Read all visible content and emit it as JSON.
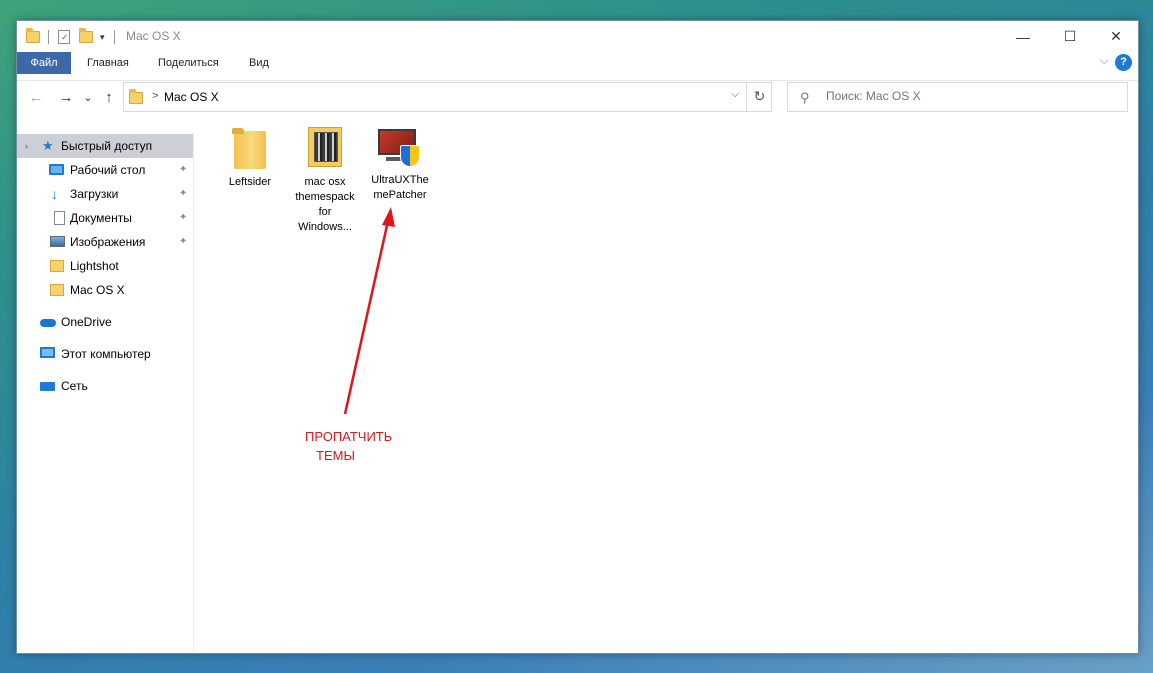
{
  "window": {
    "title": "Mac OS X",
    "controls": {
      "minimize": "—",
      "maximize": "☐",
      "close": "✕"
    }
  },
  "ribbon": {
    "tabs": [
      "Файл",
      "Главная",
      "Поделиться",
      "Вид"
    ],
    "expand_glyph": "⌵",
    "help_glyph": "?"
  },
  "navigation": {
    "back_glyph": "←",
    "forward_glyph": "→",
    "recent_glyph": "⌄",
    "up_glyph": "↑",
    "breadcrumb_sep": ">",
    "path": "Mac OS X",
    "dropdown_glyph": "⌵",
    "refresh_glyph": "↻"
  },
  "search": {
    "placeholder": "Поиск: Mac OS X",
    "icon_glyph": "⚲"
  },
  "sidebar": {
    "items": [
      {
        "label": "Быстрый доступ",
        "icon": "star-icon",
        "pinned": false
      },
      {
        "label": "Рабочий стол",
        "icon": "desktop-icon",
        "pinned": true
      },
      {
        "label": "Загрузки",
        "icon": "downloads-icon",
        "pinned": true
      },
      {
        "label": "Документы",
        "icon": "documents-icon",
        "pinned": true
      },
      {
        "label": "Изображения",
        "icon": "pictures-icon",
        "pinned": true
      },
      {
        "label": "Lightshot",
        "icon": "folder-icon",
        "pinned": false
      },
      {
        "label": "Mac OS X",
        "icon": "folder-icon",
        "pinned": false
      },
      {
        "label": "OneDrive",
        "icon": "onedrive-icon",
        "pinned": false
      },
      {
        "label": "Этот компьютер",
        "icon": "computer-icon",
        "pinned": false
      },
      {
        "label": "Сеть",
        "icon": "network-icon",
        "pinned": false
      }
    ],
    "pin_glyph": "📌",
    "expand_glyph": "›"
  },
  "files": [
    {
      "name": "Leftsider",
      "icon": "folder-icon"
    },
    {
      "name": "mac osx themespack for Windows...",
      "icon": "archive-icon"
    },
    {
      "name": "UltraUXThemePatcher",
      "icon": "installer-shield-icon"
    }
  ],
  "annotation": {
    "line1": "ПРОПАТЧИТЬ",
    "line2": "ТЕМЫ",
    "color": "#e0141a"
  }
}
